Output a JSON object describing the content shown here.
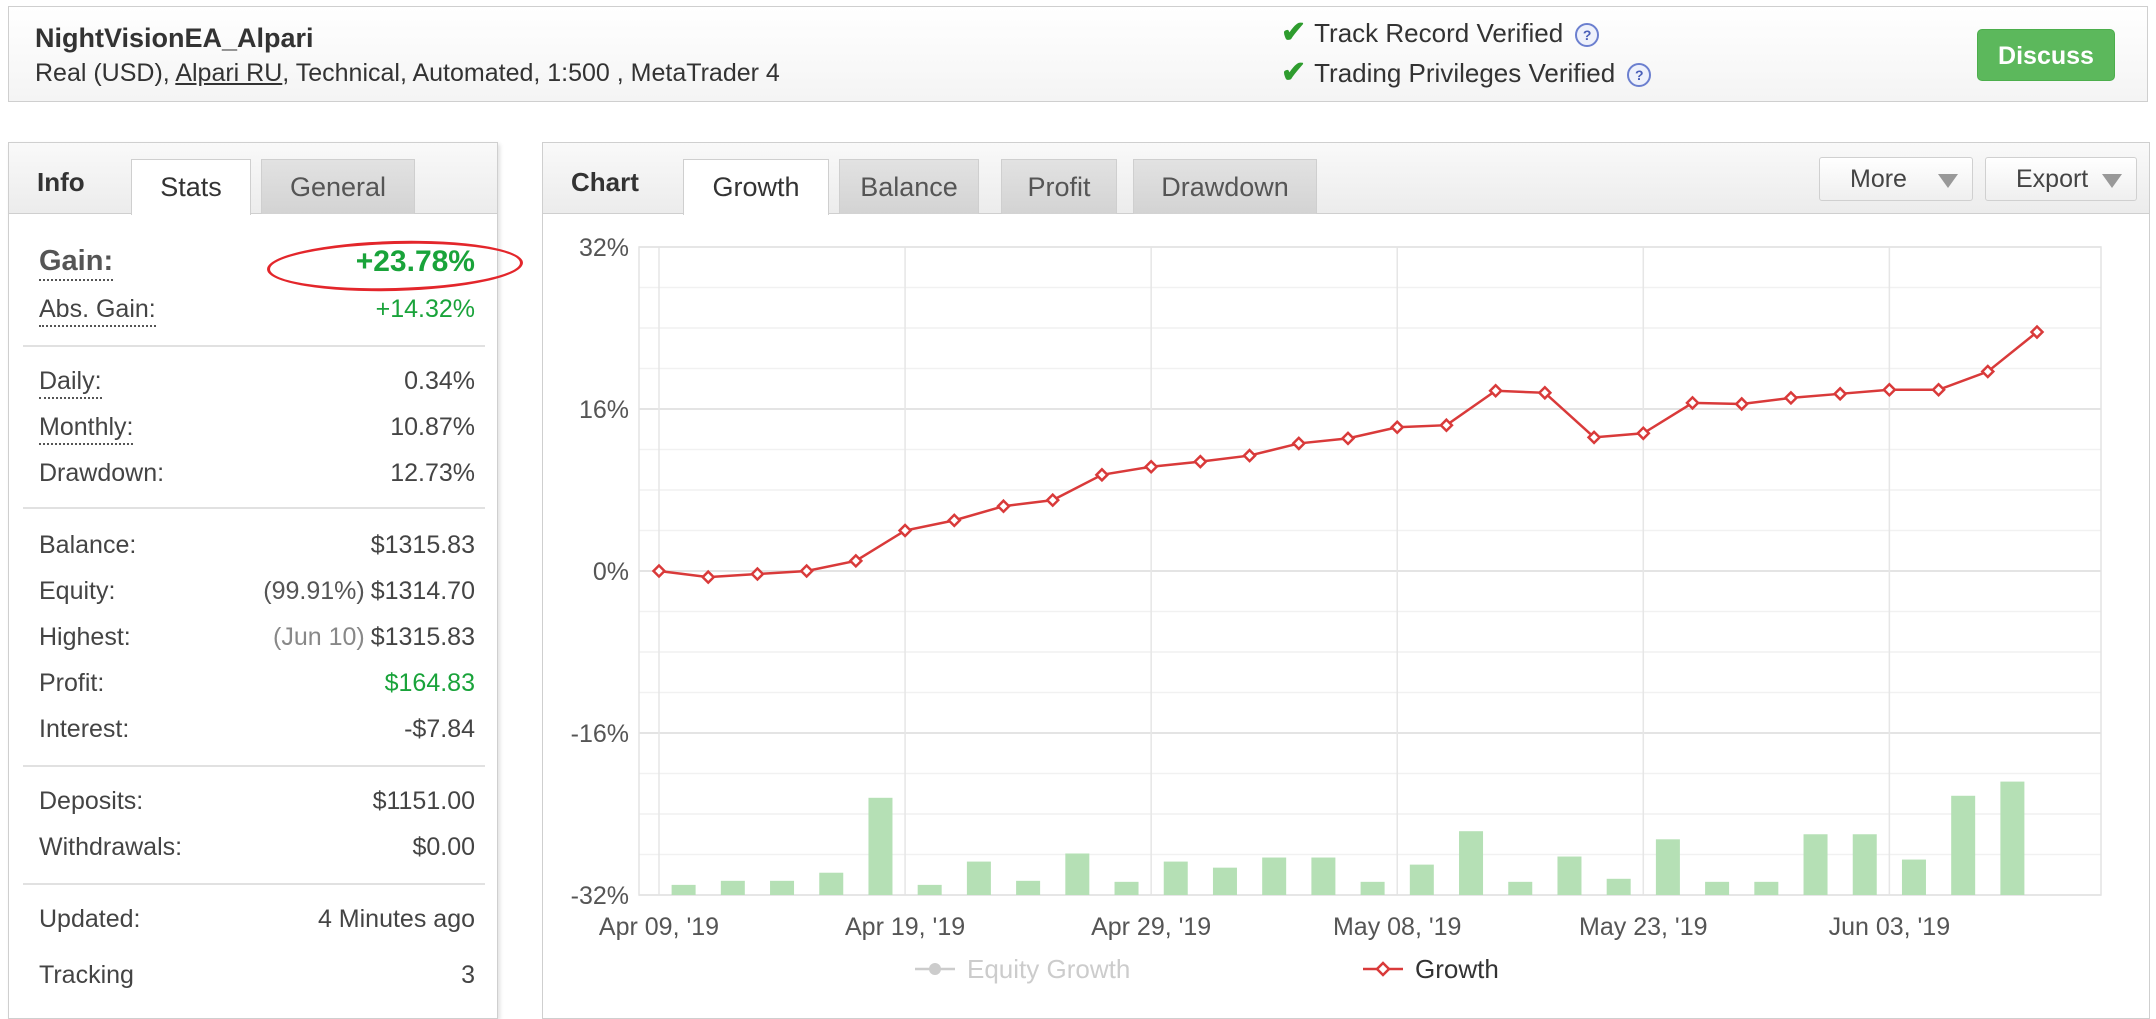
{
  "header": {
    "title": "NightVisionEA_Alpari",
    "account_type": "Real (USD), ",
    "broker": "Alpari RU",
    "details": ", Technical, Automated, 1:500 , MetaTrader 4",
    "verified": [
      {
        "label": "Track Record Verified",
        "help": "?"
      },
      {
        "label": "Trading Privileges Verified",
        "help": "?"
      }
    ],
    "discuss_label": "Discuss"
  },
  "info_panel": {
    "label": "Info",
    "tabs": [
      "Stats",
      "General"
    ],
    "gain": {
      "label": "Gain:",
      "value": "+23.78%"
    },
    "abs_gain": {
      "label": "Abs. Gain:",
      "value": "+14.32%"
    },
    "daily": {
      "label": "Daily:",
      "value": "0.34%"
    },
    "monthly": {
      "label": "Monthly:",
      "value": "10.87%"
    },
    "drawdown": {
      "label": "Drawdown:",
      "value": "12.73%"
    },
    "balance": {
      "label": "Balance:",
      "value": "$1315.83"
    },
    "equity": {
      "label": "Equity:",
      "pre": "(99.91%)",
      "value": "$1314.70"
    },
    "highest": {
      "label": "Highest:",
      "pre": "(Jun 10)",
      "value": "$1315.83"
    },
    "profit": {
      "label": "Profit:",
      "value": "$164.83"
    },
    "interest": {
      "label": "Interest:",
      "value": "-$7.84"
    },
    "deposits": {
      "label": "Deposits:",
      "value": "$1151.00"
    },
    "withdrawals": {
      "label": "Withdrawals:",
      "value": "$0.00"
    },
    "updated": {
      "label": "Updated:",
      "value": "4 Minutes ago"
    },
    "tracking": {
      "label": "Tracking",
      "value": "3"
    }
  },
  "chart_panel": {
    "label": "Chart",
    "tabs": [
      "Growth",
      "Balance",
      "Profit",
      "Drawdown"
    ],
    "active_tab": "Growth",
    "more_label": "More",
    "export_label": "Export"
  },
  "colors": {
    "growth_line": "#d93a3a",
    "bars": "#b5e0b5",
    "gain_green": "#19a33a",
    "annotation_circle": "#e3262b",
    "discuss": "#5cb85c"
  },
  "chart_data": {
    "type": "line",
    "ylim": [
      -32,
      32
    ],
    "y_ticks": [
      "32%",
      "16%",
      "0%",
      "-16%",
      "-32%"
    ],
    "y_tick_values": [
      32,
      16,
      0,
      -16,
      -32
    ],
    "x_tick_labels": [
      "Apr 09, '19",
      "Apr 19, '19",
      "Apr 29, '19",
      "May 08, '19",
      "May 23, '19",
      "Jun 03, '19"
    ],
    "legend": [
      {
        "name": "Equity Growth",
        "enabled": false
      },
      {
        "name": "Growth",
        "enabled": true
      }
    ],
    "series": [
      {
        "name": "Growth",
        "values": [
          0.0,
          -0.6,
          -0.3,
          0.0,
          1.0,
          4.0,
          5.0,
          6.4,
          7.0,
          9.5,
          10.3,
          10.8,
          11.4,
          12.6,
          13.1,
          14.2,
          14.4,
          17.8,
          17.6,
          13.2,
          13.6,
          16.6,
          16.5,
          17.1,
          17.5,
          17.9,
          17.9,
          19.7,
          23.6
        ]
      },
      {
        "name": "Bars",
        "values": [
          1,
          1.4,
          1.4,
          2.2,
          9.6,
          1.0,
          3.3,
          1.4,
          4.1,
          1.3,
          3.3,
          2.7,
          3.7,
          3.7,
          1.3,
          3.0,
          6.3,
          1.3,
          3.8,
          1.6,
          5.5,
          1.3,
          1.3,
          6.0,
          6.0,
          3.5,
          9.8,
          11.2
        ]
      }
    ]
  }
}
